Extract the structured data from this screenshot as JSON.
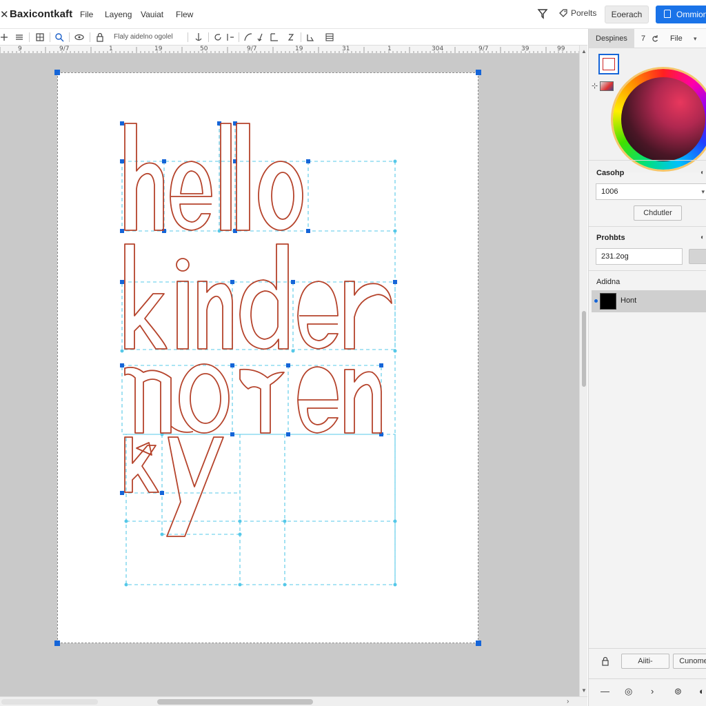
{
  "app": {
    "title": "Baxicontkaft",
    "close_glyph": "✕"
  },
  "menu": {
    "items": [
      "File",
      "Layeng",
      "Vauiat",
      "Flew"
    ]
  },
  "header": {
    "filter_icon": "filter-icon",
    "portals_label": "Porelts",
    "search_label": "Eoerach",
    "primary_label": "Ommion"
  },
  "toolbar": {
    "icons": [
      "plus-icon",
      "layers-icon",
      "grid-icon",
      "search-icon",
      "eye-icon",
      "lock-icon",
      "anchor-icon",
      "rotate-icon",
      "flip-icon",
      "down-arrow-icon",
      "curve-icon",
      "warp-icon",
      "node-icon",
      "align-icon"
    ],
    "hint_text": "Flaly aidelno ogolel"
  },
  "ruler": {
    "labels": [
      "9",
      "9/7",
      "1",
      "19",
      "50",
      "9/7",
      "19",
      "31",
      "1",
      "304",
      "9/7",
      "39",
      "99"
    ]
  },
  "canvas": {
    "words": [
      "hello",
      "kinder",
      "noren",
      "ky"
    ],
    "stroke_color": "#b5432b",
    "guide_color": "#55c8e8",
    "handle_color": "#1565d8"
  },
  "panel": {
    "tabs": [
      "Despines",
      "7",
      "File"
    ],
    "color_section_label": "Casohp",
    "color_section_mark": "◐",
    "color_value": "1006",
    "color_button": "Chdutler",
    "props_label": "Prohbts",
    "props_mark": "◐",
    "props_value": "231.2og",
    "assign_label": "Adidna",
    "swatch_item_label": "Hont",
    "swatch_item_color": "#000000",
    "footer_button_1": "Aiiti-",
    "footer_button_2": "Cunome"
  }
}
